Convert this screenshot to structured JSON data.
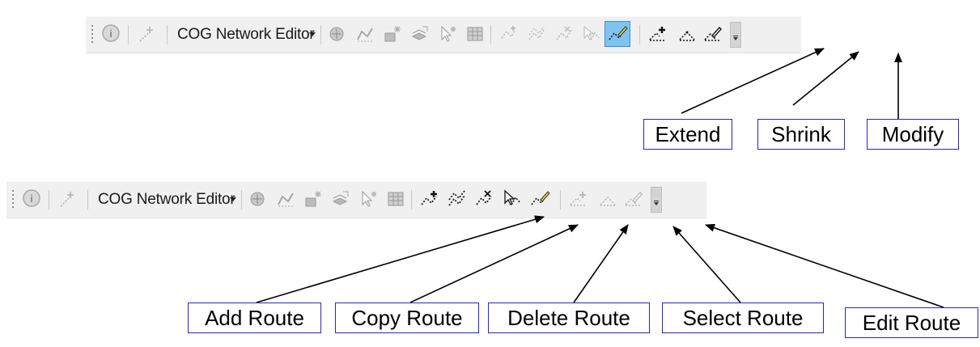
{
  "toolbar_top": {
    "menu_label": "COG Network Editor",
    "selected_tool": "edit-route",
    "tools": [
      "identify",
      "feature",
      "network-a",
      "network-b",
      "network-c",
      "network-d",
      "select-pointer",
      "table",
      "add-route",
      "copy-route",
      "delete-route",
      "select-route",
      "edit-route",
      "extend",
      "shrink",
      "modify"
    ]
  },
  "toolbar_bottom": {
    "menu_label": "COG Network Editor",
    "tools": [
      "identify",
      "feature",
      "network-a",
      "network-b",
      "network-c",
      "network-d",
      "select-pointer",
      "table",
      "add-route",
      "copy-route",
      "delete-route",
      "select-route",
      "edit-route",
      "extend",
      "shrink",
      "modify"
    ]
  },
  "callouts_top": {
    "extend": "Extend",
    "shrink": "Shrink",
    "modify": "Modify"
  },
  "callouts_bottom": {
    "add_route": "Add Route",
    "copy_route": "Copy Route",
    "delete_route": "Delete Route",
    "select_route": "Select Route",
    "edit_route": "Edit Route"
  },
  "colors": {
    "callout_border": "#2626c8",
    "selected_bg": "#7fc3ee",
    "toolbar_bg": "#f0f0f0"
  }
}
